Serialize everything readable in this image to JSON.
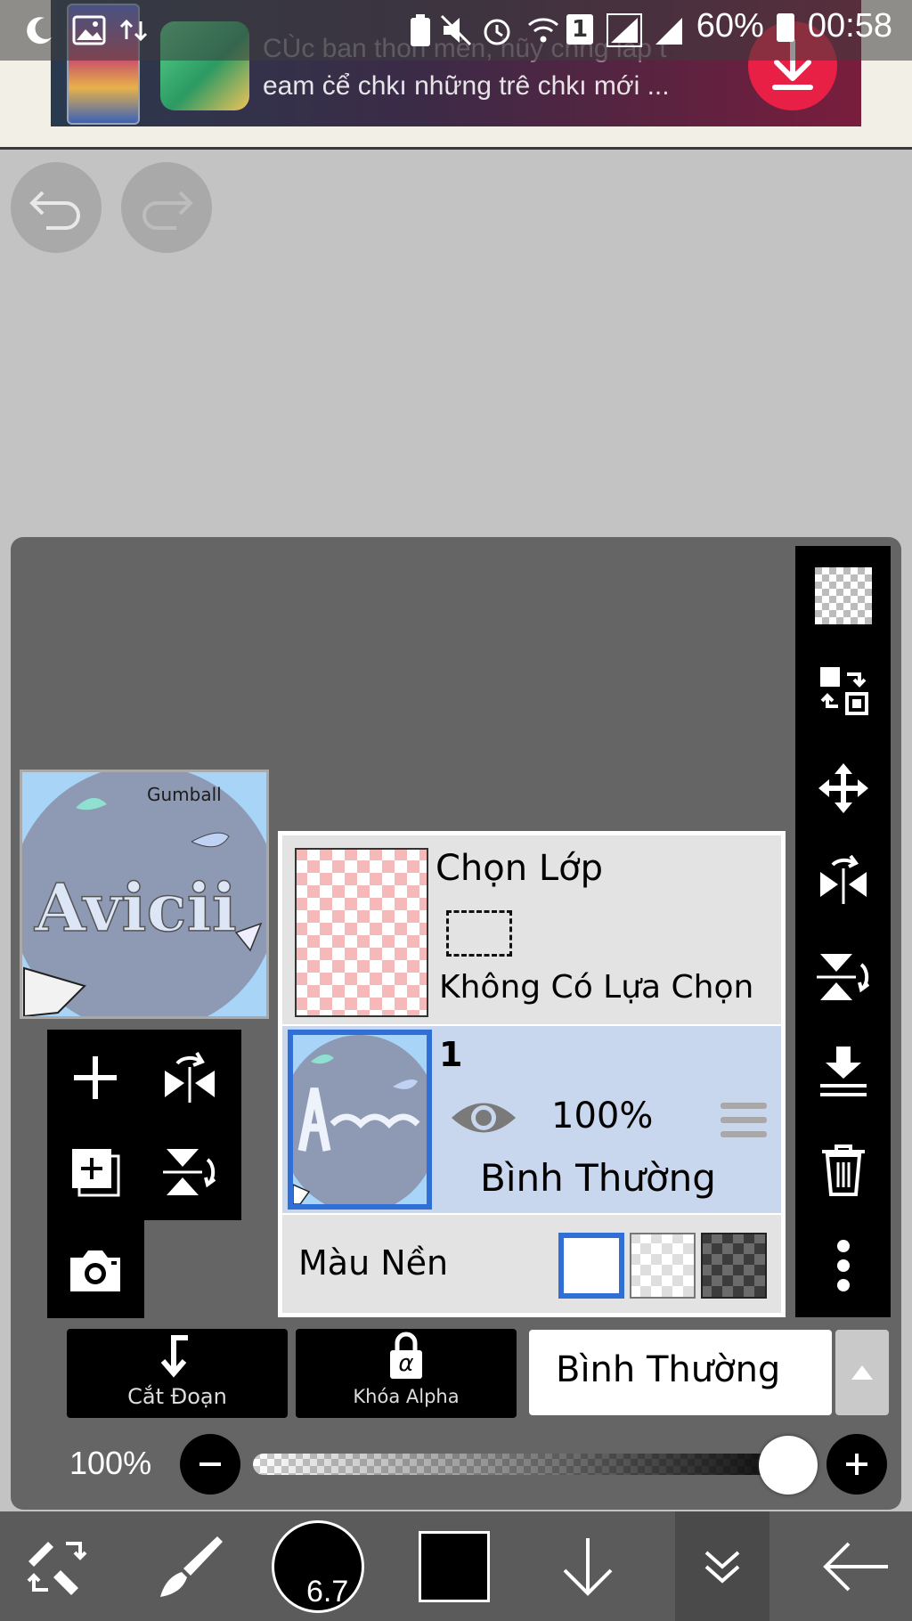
{
  "status_bar": {
    "battery_percent": "60%",
    "time": "00:58",
    "sim_label": "1"
  },
  "ad": {
    "line1": "CÙc ban thon mên, hũy cnng lap t",
    "line2": "eam ċể chkı những trê chkı mới ...",
    "download_icon": "download-icon"
  },
  "toolbar_top": {
    "undo_icon": "undo-icon",
    "redo_icon": "redo-icon"
  },
  "layer_panel": {
    "preview_caption_line1": "Gumball",
    "preview_caption_line2": "Avicii",
    "selection_layer": {
      "title": "Chọn Lớp",
      "subtitle": "Không Có Lựa Chọn"
    },
    "layer1": {
      "name": "1",
      "opacity": "100%",
      "blend": "Bình Thường",
      "visible": true
    },
    "background": {
      "label": "Màu Nền",
      "options": [
        "white",
        "transparent",
        "dark-checker"
      ],
      "selected": "white"
    }
  },
  "buttons": {
    "clip_label": "Cắt Đoạn",
    "alpha_lock_label": "Khóa Alpha",
    "alpha_symbol": "α",
    "blend_mode": "Bình Thường"
  },
  "opacity": {
    "label": "100%",
    "value": 1.0
  },
  "bottom_bar": {
    "brush_size": "6.7"
  },
  "colors": {
    "panel": "#656565",
    "accent_blue": "#2f6fd6",
    "toolbar": "#000000",
    "selection_row": "#e3e3e3",
    "active_layer_row": "#c8d6ee"
  }
}
